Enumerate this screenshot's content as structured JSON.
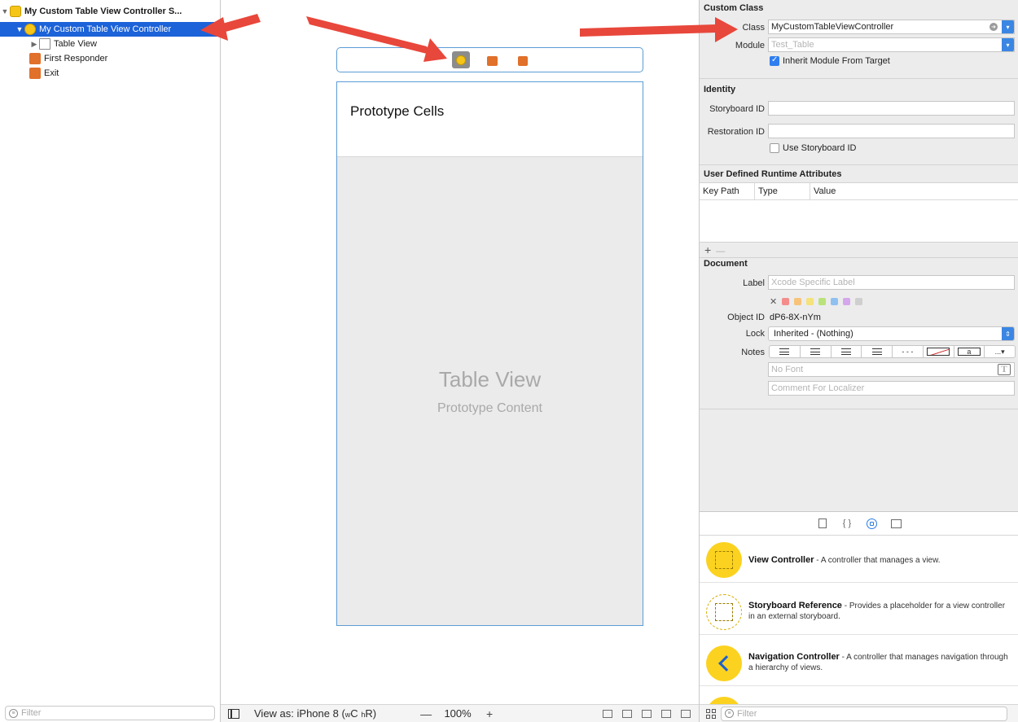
{
  "outline": {
    "items": [
      {
        "label": "My Custom Table View Controller S...",
        "icon": "scene-icon"
      },
      {
        "label": "My Custom Table View Controller",
        "icon": "view-controller-icon"
      },
      {
        "label": "Table View",
        "icon": "table-view-icon"
      },
      {
        "label": "First Responder",
        "icon": "first-responder-icon"
      },
      {
        "label": "Exit",
        "icon": "exit-icon"
      }
    ],
    "filter_placeholder": "Filter"
  },
  "canvas": {
    "prototype_cells_label": "Prototype Cells",
    "table_view_title": "Table View",
    "table_view_subtitle": "Prototype Content",
    "bottom_bar": {
      "view_as": "View as: iPhone 8",
      "size_class_w": "C",
      "size_class_h": "R",
      "zoom_out": "—",
      "zoom": "100%",
      "zoom_in": "+"
    }
  },
  "inspector": {
    "custom_class": {
      "section_title": "Custom Class",
      "class_label": "Class",
      "class_value": "MyCustomTableViewController",
      "module_label": "Module",
      "module_placeholder": "Test_Table",
      "inherit_label": "Inherit Module From Target",
      "inherit_checked": true
    },
    "identity": {
      "section_title": "Identity",
      "storyboard_id_label": "Storyboard ID",
      "storyboard_id_value": "",
      "restoration_id_label": "Restoration ID",
      "restoration_id_value": "",
      "use_storyboard_id_label": "Use Storyboard ID",
      "use_storyboard_id_checked": false
    },
    "runtime_attributes": {
      "section_title": "User Defined Runtime Attributes",
      "columns": [
        "Key Path",
        "Type",
        "Value"
      ],
      "add": "+",
      "remove": "—"
    },
    "document": {
      "section_title": "Document",
      "label_label": "Label",
      "label_placeholder": "Xcode Specific Label",
      "clear_swatch": "✕",
      "swatch_colors": [
        "#f58c8c",
        "#f7c37a",
        "#f5e27a",
        "#b9e27a",
        "#8fc1f0",
        "#d4a7ec",
        "#cfcfcf"
      ],
      "object_id_label": "Object ID",
      "object_id_value": "dP6-8X-nYm",
      "lock_label": "Lock",
      "lock_value": "Inherited - (Nothing)",
      "notes_label": "Notes",
      "font_placeholder": "No Font",
      "font_button": "T",
      "box_a": "a",
      "more": "...",
      "comment_placeholder": "Comment For Localizer"
    }
  },
  "library": {
    "items": [
      {
        "title": "View Controller",
        "desc": " - A controller that manages a view."
      },
      {
        "title": "Storyboard Reference",
        "desc": " - Provides a placeholder for a view controller in an external storyboard."
      },
      {
        "title": "Navigation Controller",
        "desc": " - A controller that manages navigation through a hierarchy of views."
      }
    ],
    "filter_placeholder": "Filter"
  },
  "colors": {
    "selection": "#1c62d8",
    "accent": "#3b86e3",
    "annotation_arrow": "#e8473b",
    "object_yellow": "#f5c518",
    "object_orange": "#e0702a"
  }
}
